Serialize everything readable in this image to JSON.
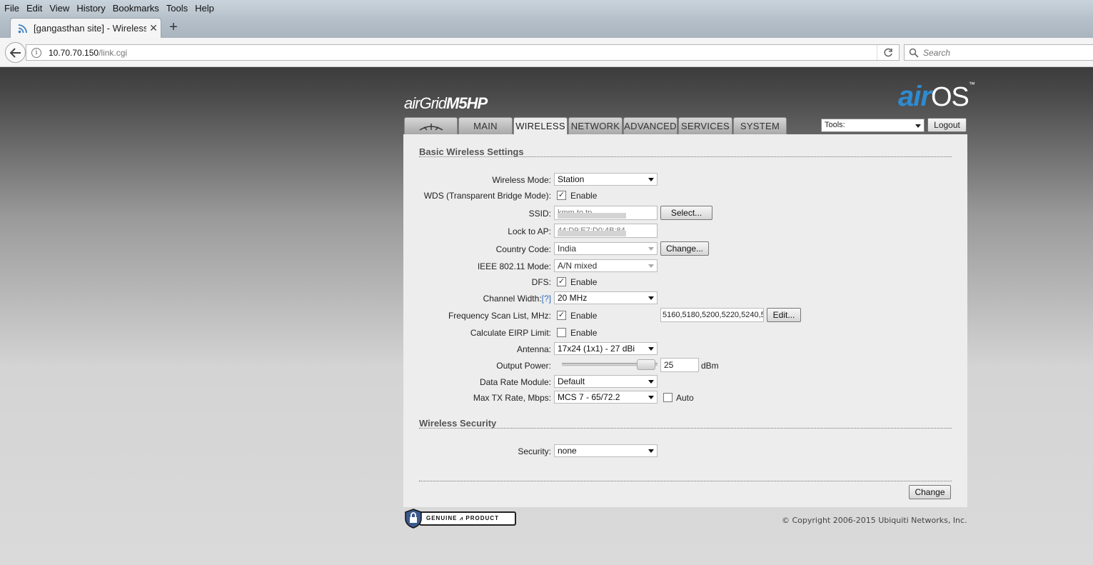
{
  "browser": {
    "menu": [
      "File",
      "Edit",
      "View",
      "History",
      "Bookmarks",
      "Tools",
      "Help"
    ],
    "tab_title": "[gangasthan site] - Wireless",
    "new_tab": "+",
    "url_host": "10.70.70.150",
    "url_path": "/link.cgi",
    "search_placeholder": "Search"
  },
  "header": {
    "product_air": "air",
    "product_grid": "Grid",
    "product_model": "M5HP",
    "brand_air": "air",
    "brand_os": "OS",
    "brand_tm": "™",
    "tabs": [
      "MAIN",
      "WIRELESS",
      "NETWORK",
      "ADVANCED",
      "SERVICES",
      "SYSTEM"
    ],
    "active_tab": "WIRELESS",
    "tools_value": "Tools:",
    "logout_label": "Logout"
  },
  "basic": {
    "title": "Basic Wireless Settings",
    "wireless_mode_label": "Wireless Mode:",
    "wireless_mode_value": "Station",
    "wds_label": "WDS (Transparent Bridge Mode):",
    "wds_checked": "✓",
    "enable": "Enable",
    "ssid_label": "SSID:",
    "ssid_value": "kmm to tp",
    "select_btn": "Select...",
    "lock_ap_label": "Lock to AP:",
    "lock_ap_value": "44:D9:E7:D0:4B:84",
    "country_label": "Country Code:",
    "country_value": "India",
    "change_btn": "Change...",
    "ieee_label": "IEEE 802.11 Mode:",
    "ieee_value": "A/N mixed",
    "dfs_label": "DFS:",
    "channel_width_label": "Channel Width:",
    "channel_width_help": "[?]",
    "channel_width_value": "20 MHz",
    "freq_label": "Frequency Scan List, MHz:",
    "freq_value": "5160,5180,5200,5220,5240,5",
    "edit_btn": "Edit...",
    "eirp_label": "Calculate EIRP Limit:",
    "antenna_label": "Antenna:",
    "antenna_value": "17x24 (1x1) - 27 dBi",
    "output_power_label": "Output Power:",
    "output_power_value": "25",
    "output_power_unit": "dBm",
    "data_rate_label": "Data Rate Module:",
    "data_rate_value": "Default",
    "max_tx_label": "Max TX Rate, Mbps:",
    "max_tx_value": "MCS 7 - 65/72.2",
    "auto_label": "Auto"
  },
  "security": {
    "title": "Wireless Security",
    "security_label": "Security:",
    "security_value": "none"
  },
  "footer": {
    "change_btn": "Change",
    "genuine_text": "GENUINE ⩘ PRODUCT",
    "copyright": "© Copyright 2006-2015 Ubiquiti Networks, Inc."
  },
  "colors": {
    "accent_blue": "#2f8bd0",
    "help_link": "#2a6fbf"
  }
}
